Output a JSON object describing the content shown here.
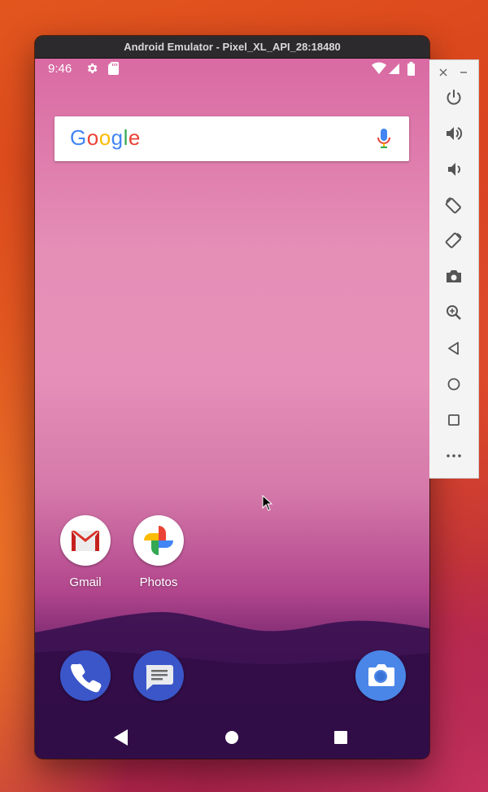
{
  "window": {
    "title": "Android Emulator - Pixel_XL_API_28:18480"
  },
  "statusbar": {
    "time": "9:46"
  },
  "search": {
    "logo": [
      "G",
      "o",
      "o",
      "g",
      "l",
      "e"
    ],
    "logo_colors": [
      "#4285F4",
      "#EA4335",
      "#FBBC05",
      "#4285F4",
      "#34A853",
      "#EA4335"
    ]
  },
  "apps": [
    {
      "label": "Gmail"
    },
    {
      "label": "Photos"
    }
  ],
  "dock": [
    "phone-app",
    "messages-app",
    "camera-app"
  ],
  "navbar": [
    "back",
    "home",
    "overview"
  ],
  "toolbar": {
    "window_controls": [
      "close",
      "minimize"
    ],
    "buttons": [
      "power",
      "volume-up",
      "volume-down",
      "rotate-left",
      "rotate-right",
      "take-screenshot",
      "zoom",
      "back",
      "home",
      "overview",
      "more"
    ]
  },
  "colors": {
    "accent_blue": "#3a56c9",
    "camera_blue": "#4a86e8",
    "toolbar_icon": "#555555"
  }
}
